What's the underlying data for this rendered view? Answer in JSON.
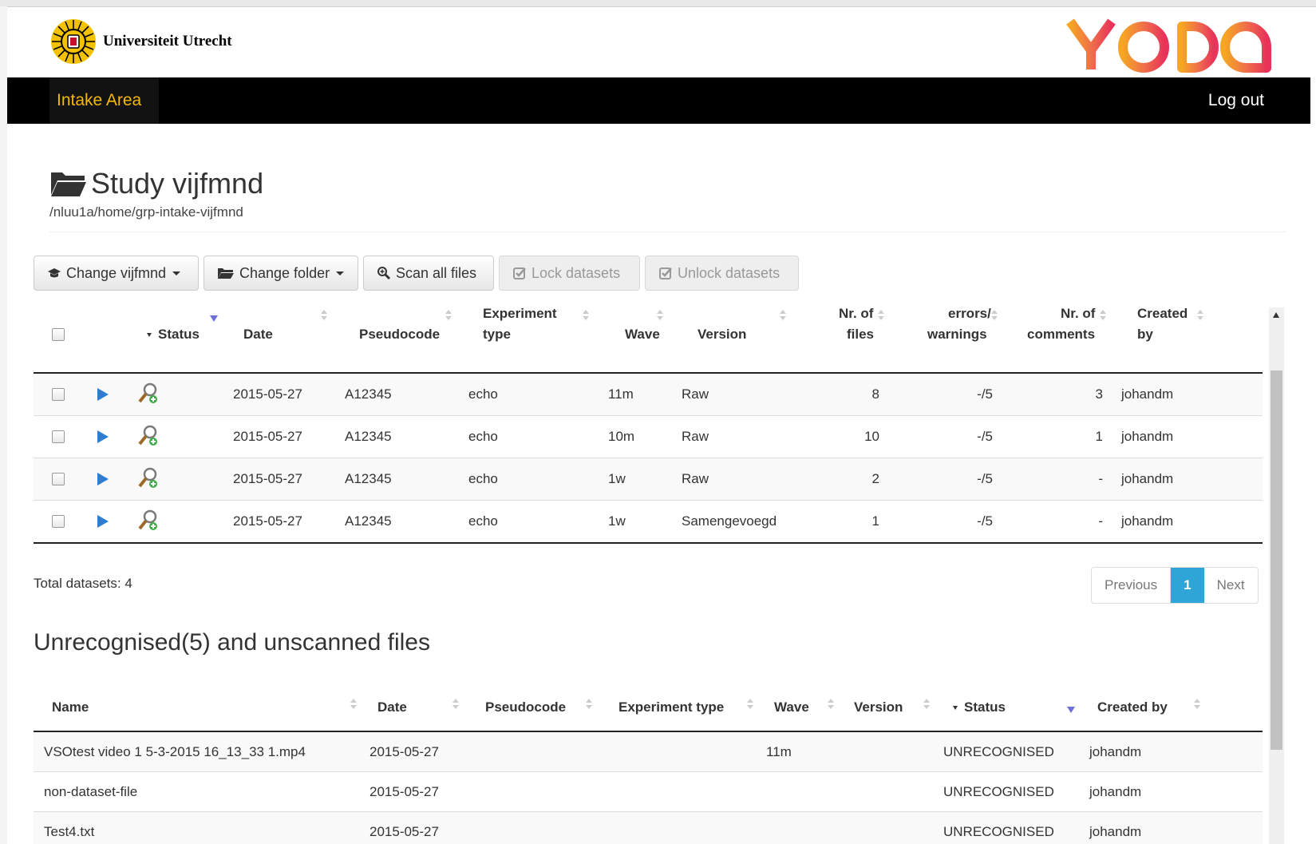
{
  "header": {
    "university_name": "Universiteit Utrecht",
    "app_logo_text": "YODA"
  },
  "navbar": {
    "brand": "Intake Area",
    "logout": "Log out"
  },
  "study": {
    "title": "Study vijfmnd",
    "path": "/nluu1a/home/grp-intake-vijfmnd"
  },
  "toolbar": {
    "change_study": "Change vijfmnd",
    "change_folder": "Change folder",
    "scan_all": "Scan all files",
    "lock": "Lock datasets",
    "unlock": "Unlock datasets"
  },
  "datasets": {
    "columns": {
      "status": "Status",
      "date": "Date",
      "pseudocode": "Pseudocode",
      "experiment_type_1": "Experiment",
      "experiment_type_2": "type",
      "wave": "Wave",
      "version": "Version",
      "nr_files_1": "Nr. of",
      "nr_files_2": "files",
      "errors_1": "errors/",
      "errors_2": "warnings",
      "comments_1": "Nr. of",
      "comments_2": "comments",
      "created_1": "Created",
      "created_2": "by"
    },
    "rows": [
      {
        "date": "2015-05-27",
        "pseudocode": "A12345",
        "experiment_type": "echo",
        "wave": "11m",
        "version": "Raw",
        "nr_files": "8",
        "errors": "-/5",
        "comments": "3",
        "created_by": "johandm"
      },
      {
        "date": "2015-05-27",
        "pseudocode": "A12345",
        "experiment_type": "echo",
        "wave": "10m",
        "version": "Raw",
        "nr_files": "10",
        "errors": "-/5",
        "comments": "1",
        "created_by": "johandm"
      },
      {
        "date": "2015-05-27",
        "pseudocode": "A12345",
        "experiment_type": "echo",
        "wave": "1w",
        "version": "Raw",
        "nr_files": "2",
        "errors": "-/5",
        "comments": "-",
        "created_by": "johandm"
      },
      {
        "date": "2015-05-27",
        "pseudocode": "A12345",
        "experiment_type": "echo",
        "wave": "1w",
        "version": "Samengevoegd",
        "nr_files": "1",
        "errors": "-/5",
        "comments": "-",
        "created_by": "johandm"
      }
    ],
    "total": "Total datasets: 4"
  },
  "pagination": {
    "previous": "Previous",
    "current": "1",
    "next": "Next"
  },
  "unrecognised": {
    "heading": "Unrecognised(5) and unscanned files",
    "columns": {
      "name": "Name",
      "date": "Date",
      "pseudocode": "Pseudocode",
      "experiment_type": "Experiment type",
      "wave": "Wave",
      "version": "Version",
      "status": "Status",
      "created_by": "Created by"
    },
    "rows": [
      {
        "name": "VSOtest video 1 5-3-2015 16_13_33 1.mp4",
        "date": "2015-05-27",
        "wave": "11m",
        "status": "UNRECOGNISED",
        "created_by": "johandm"
      },
      {
        "name": "non-dataset-file",
        "date": "2015-05-27",
        "wave": "",
        "status": "UNRECOGNISED",
        "created_by": "johandm"
      },
      {
        "name": "Test4.txt",
        "date": "2015-05-27",
        "wave": "",
        "status": "UNRECOGNISED",
        "created_by": "johandm"
      }
    ]
  },
  "colors": {
    "navbar_bg": "#000000",
    "brand": "#f5b800",
    "pager_active": "#2fa4d7",
    "sort_active": "#6f6fd8"
  }
}
